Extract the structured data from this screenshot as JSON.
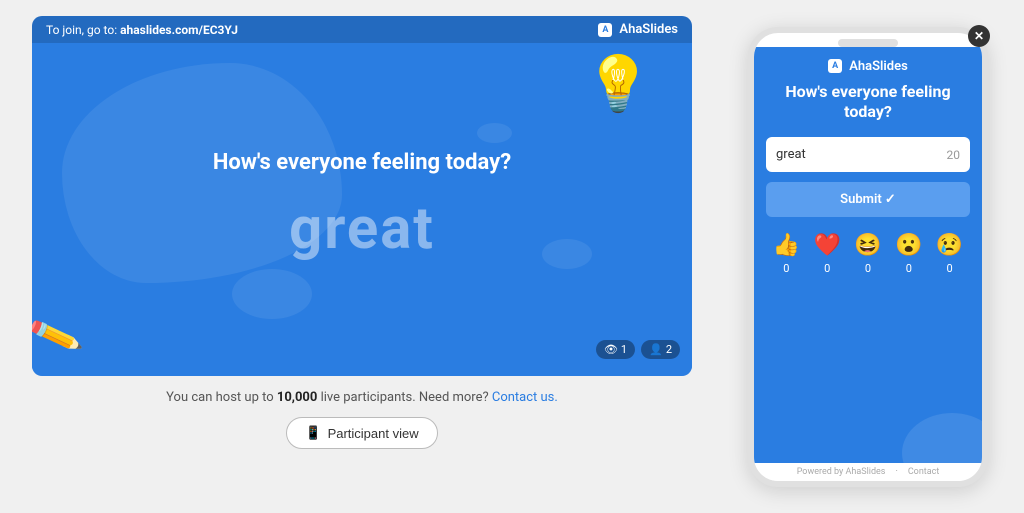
{
  "slide": {
    "join_text": "To join, go to:",
    "join_url": "ahaslides.com/EC3YJ",
    "logo": "AhaSlides",
    "question": "How's everyone feeling today?",
    "word": "great",
    "badges": {
      "viewers": "1",
      "participants": "2"
    }
  },
  "bottom_info": {
    "text_before": "You can host up to ",
    "highlight": "10,000",
    "text_middle": " live participants. Need more? ",
    "contact_link": "Contact us."
  },
  "participant_btn": {
    "label": "Participant view"
  },
  "phone": {
    "logo": "AhaSlides",
    "question": "How's everyone feeling today?",
    "input_value": "great",
    "char_count": "20",
    "submit_label": "Submit ✓",
    "reactions": [
      {
        "emoji": "👍",
        "count": "0",
        "name": "thumbs-up"
      },
      {
        "emoji": "❤️",
        "count": "0",
        "name": "heart"
      },
      {
        "emoji": "😆",
        "count": "0",
        "name": "laughing"
      },
      {
        "emoji": "😮",
        "count": "0",
        "name": "wow"
      },
      {
        "emoji": "😢",
        "count": "0",
        "name": "sad"
      }
    ],
    "footer_powered": "Powered by AhaSlides",
    "footer_contact": "Contact"
  },
  "close_btn_label": "✕",
  "colors": {
    "brand_blue": "#2a7de1",
    "accent": "#5a9eef"
  }
}
